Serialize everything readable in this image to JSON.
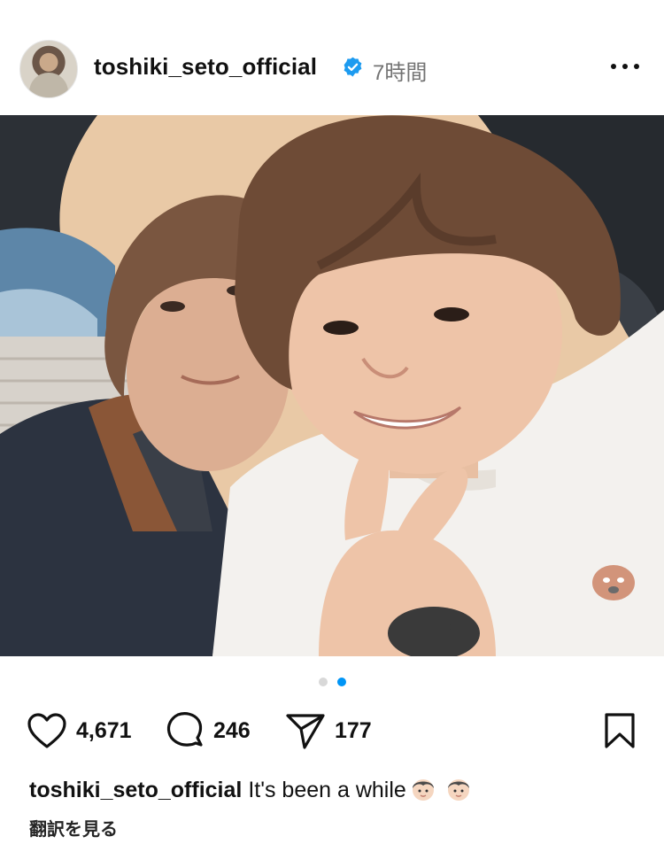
{
  "post": {
    "username": "toshiki_seto_official",
    "time_ago": "7時間",
    "likes": "4,671",
    "comments": "246",
    "shares": "177",
    "caption_username": "toshiki_seto_official",
    "caption_text": "It's been a while",
    "caption_emojis": [
      "boy-emoji",
      "boy-emoji"
    ],
    "translate_label": "翻訳を見る",
    "carousel_count": 2,
    "carousel_active_index": 1
  },
  "colors": {
    "verified": "#1d9bf0",
    "dot_active": "#0095f6",
    "dot_inactive": "#d8d8d8",
    "secondary_text": "#737373"
  }
}
